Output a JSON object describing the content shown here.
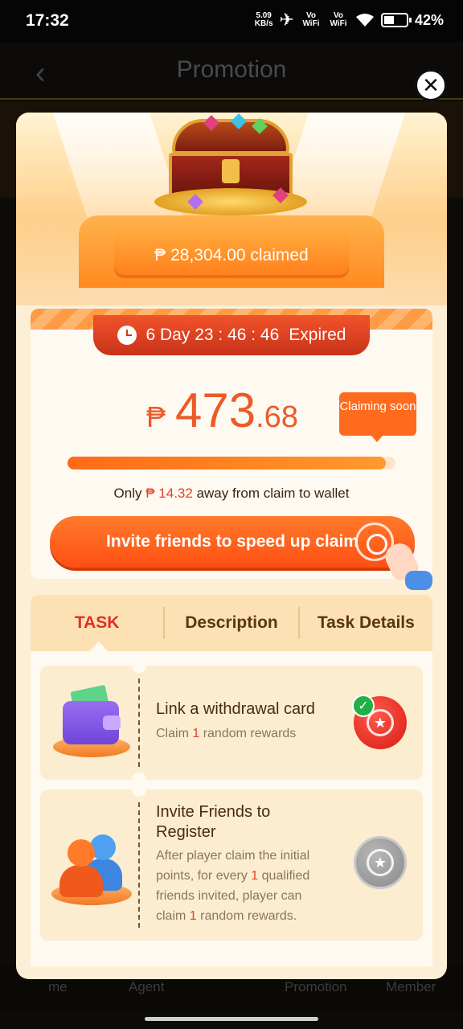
{
  "status_bar": {
    "time": "17:32",
    "net_speed": "5.09",
    "net_unit": "KB/s",
    "sim1": "Vo WiFi",
    "sim2": "Vo WiFi",
    "battery": "42%"
  },
  "app_header": {
    "title": "Promotion"
  },
  "bottom_nav": [
    "me",
    "Agent",
    "Promotion",
    "Member"
  ],
  "modal": {
    "claimed": "₱ 28,304.00 claimed",
    "timer": "6 Day 23 : 46 : 46",
    "timer_status": "Expired",
    "amount_currency": "₱",
    "amount_int": "473",
    "amount_dec": ".68",
    "claiming_soon": "Claiming soon",
    "progress_fraction": 0.97,
    "away": {
      "prefix": "Only",
      "amount": "₱ 14.32",
      "suffix": "away from claim to wallet"
    },
    "invite_button": "Invite friends to speed up claim",
    "tabs": [
      "TASK",
      "Description",
      "Task Details"
    ],
    "tasks": [
      {
        "title": "Link a withdrawal card",
        "desc_prefix": "Claim",
        "desc_num": "1",
        "desc_suffix": "random rewards",
        "completed": true
      },
      {
        "title": "Invite Friends to Register",
        "desc_prefix": "After player claim the initial points, for every",
        "desc_num": "1",
        "desc_mid": "qualified friends invited, player can claim",
        "desc_num2": "1",
        "desc_suffix": "random rewards.",
        "completed": false
      }
    ]
  },
  "colors": {
    "accent": "#ff5a14",
    "amount": "#ec5b27",
    "active_tab": "#e0302a",
    "completed": "#20b045"
  },
  "icons": [
    "back-arrow-icon",
    "close-icon",
    "clock-icon",
    "wallet-icon",
    "friends-icon",
    "reward-icon",
    "check-icon",
    "pointing-hand-icon"
  ]
}
